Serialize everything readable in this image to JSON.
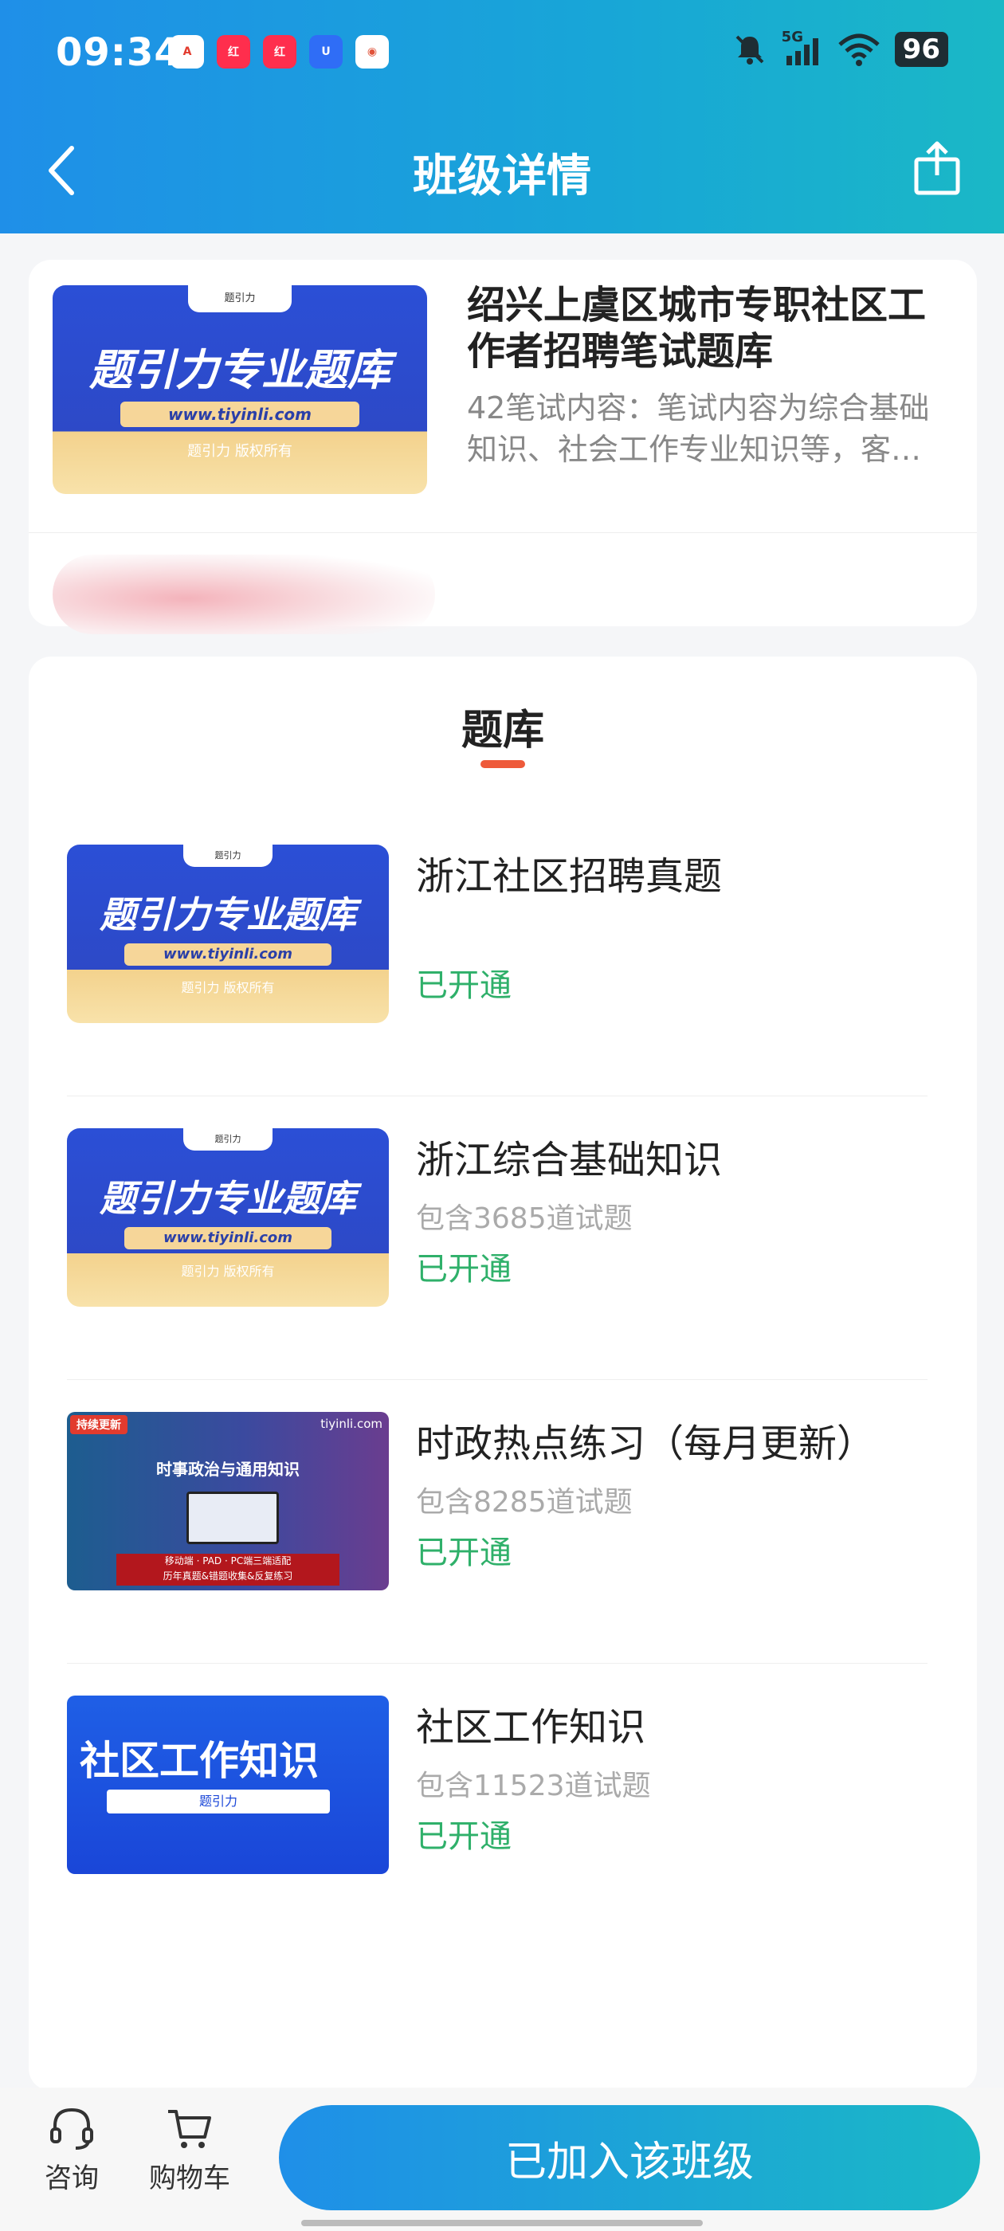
{
  "status_bar": {
    "time": "09:34",
    "network": "5G",
    "battery": "96",
    "app_icons": [
      "app-a-icon",
      "xiaohongshu-icon",
      "xiaohongshu-icon",
      "app-u-icon",
      "game-icon"
    ]
  },
  "header": {
    "title": "班级详情",
    "back_icon": "chevron-left-icon",
    "share_icon": "share-icon"
  },
  "class_info": {
    "title": "绍兴上虞区城市专职社区工作者招聘笔试题库",
    "description": "42笔试内容：笔试内容为综合基础知识、社会工作专业知识等，客…",
    "cover": {
      "brand": "题引力",
      "headline": "题引力专业题库",
      "url": "www.tiyinli.com",
      "copyright": "题引力 版权所有"
    }
  },
  "bank": {
    "heading": "题库",
    "items": [
      {
        "title": "浙江社区招聘真题",
        "count": "",
        "status": "已开通",
        "cover": {
          "brand": "题引力",
          "headline": "题引力专业题库",
          "url": "www.tiyinli.com",
          "copyright": "题引力 版权所有"
        }
      },
      {
        "title": "浙江综合基础知识",
        "count": "包含3685道试题",
        "status": "已开通",
        "cover": {
          "brand": "题引力",
          "headline": "题引力专业题库",
          "url": "www.tiyinli.com",
          "copyright": "题引力 版权所有"
        }
      },
      {
        "title": "时政热点练习（每月更新）",
        "count": "包含8285道试题",
        "status": "已开通",
        "cover": {
          "tag": "持续更新",
          "site": "tiyinli.com",
          "headline": "时事政治与通用知识",
          "footer1": "移动端 · PAD · PC端三端适配",
          "footer2": "历年真题&错题收集&反复练习"
        }
      },
      {
        "title": "社区工作知识",
        "count": "包含11523道试题",
        "status": "已开通",
        "cover": {
          "headline": "社区工作知识",
          "brand": "题引力"
        }
      }
    ]
  },
  "bottom_bar": {
    "consult_label": "咨询",
    "cart_label": "购物车",
    "join_label": "已加入该班级"
  },
  "colors": {
    "accent_start": "#1f8fe8",
    "accent_end": "#1ab8c6",
    "status_green": "#2fb06a",
    "underline_red": "#ee5a3a"
  }
}
